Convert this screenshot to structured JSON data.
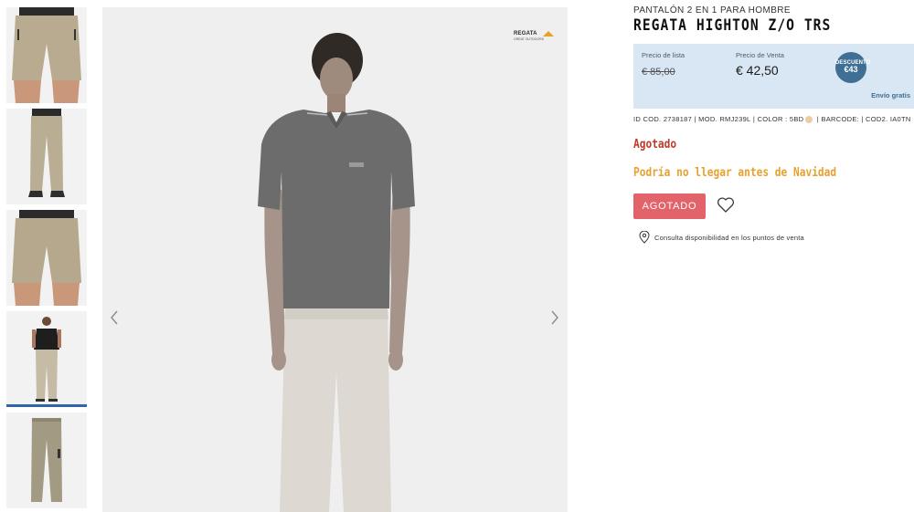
{
  "product": {
    "category": "PANTALÓN 2 EN 1 PARA HOMBRE",
    "title": "REGATA HIGHTON Z/O TRS"
  },
  "pricing": {
    "list_label": "Precio de lista",
    "list_price": "€ 85,00",
    "sale_label": "Precio de Venta",
    "sale_price": "€ 42,50",
    "discount_label": "DESCUENTO",
    "discount_value": "€43",
    "shipping": "Envío gratis"
  },
  "meta": {
    "id_cod": "ID COD. 2738187",
    "mod": "MOD. RMJ239L",
    "color_label": "COLOR :",
    "color_code": "5BD",
    "barcode": "BARCODE:",
    "cod2": "COD2. IA0TN",
    "sep": "|"
  },
  "availability": {
    "stock": "Agotado",
    "christmas_notice": "Podría no llegar antes de Navidad"
  },
  "actions": {
    "soldout_button": "AGOTADO",
    "store_check": "Consulta disponibilidad en los puntos de venta"
  },
  "gallery": {
    "brand": "REGATA",
    "brand_sub": "GREAT OUTDOORS",
    "thumbnails": [
      "shorts-front",
      "trousers-back",
      "shorts-back",
      "model-full",
      "trousers-flat"
    ],
    "active_thumbnail": 3
  },
  "colors": {
    "accent_blue": "#3f6f94",
    "price_box": "#d9e6f3",
    "soldout": "#e2636a",
    "stock_red": "#c0392b",
    "notice_orange": "#e6a12e"
  }
}
